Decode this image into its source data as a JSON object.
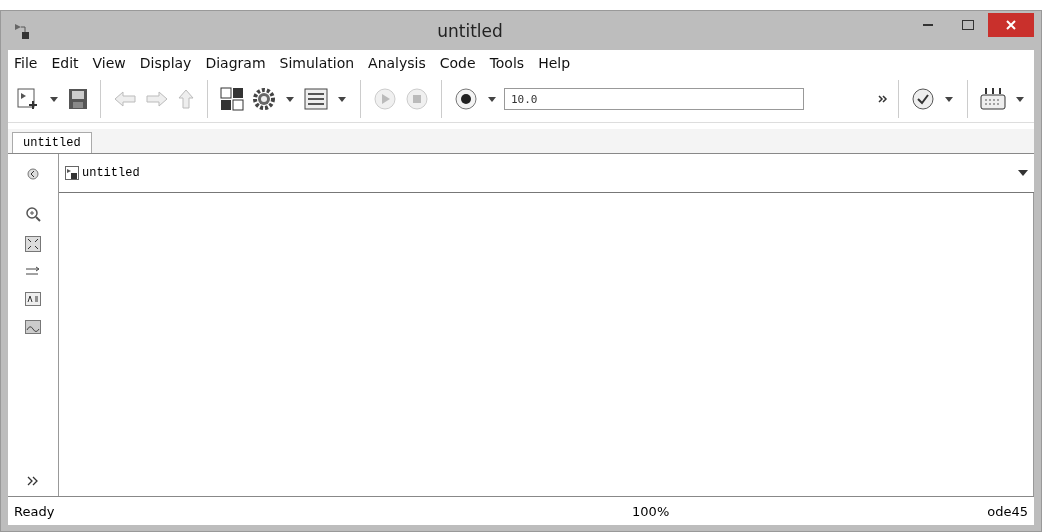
{
  "window": {
    "title": "untitled"
  },
  "menu": [
    "File",
    "Edit",
    "View",
    "Display",
    "Diagram",
    "Simulation",
    "Analysis",
    "Code",
    "Tools",
    "Help"
  ],
  "toolbar": {
    "stop_time": "10.0"
  },
  "tabs": [
    {
      "label": "untitled",
      "selected": true
    }
  ],
  "address_bar": {
    "path": "untitled"
  },
  "status_bar": {
    "status": "Ready",
    "zoom": "100%",
    "solver": "ode45"
  }
}
